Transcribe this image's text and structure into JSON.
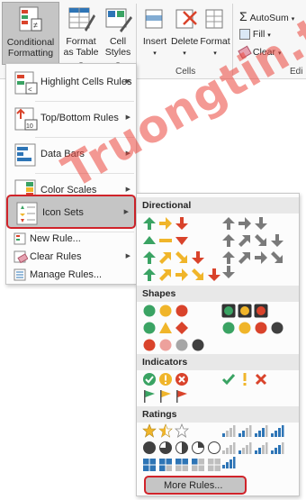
{
  "ribbon": {
    "conditional_formatting": "Conditional Formatting",
    "format_as_table": "Format as Table",
    "cell_styles": "Cell Styles",
    "insert": "Insert",
    "delete": "Delete",
    "format": "Format",
    "cells_group": "Cells",
    "autosum": "AutoSum",
    "fill": "Fill",
    "clear": "Clear",
    "editing_group_partial": "Edi"
  },
  "menu": {
    "items": [
      {
        "label": "Highlight Cells Rules",
        "has_submenu": true
      },
      {
        "label": "Top/Bottom Rules",
        "has_submenu": true
      },
      {
        "label": "Data Bars",
        "has_submenu": true
      },
      {
        "label": "Color Scales",
        "has_submenu": true
      },
      {
        "label": "Icon Sets",
        "has_submenu": true,
        "selected": true
      },
      {
        "label": "New Rule..."
      },
      {
        "label": "Clear Rules",
        "has_submenu": true
      },
      {
        "label": "Manage Rules..."
      }
    ]
  },
  "submenu": {
    "sections": [
      {
        "title": "Directional"
      },
      {
        "title": "Shapes"
      },
      {
        "title": "Indicators"
      },
      {
        "title": "Ratings"
      }
    ],
    "more_rules": "More Rules..."
  },
  "watermark": "Truongtin.top",
  "colors": {
    "green": "#3aa363",
    "yellow": "#f0b52a",
    "red": "#d9432b",
    "gray": "#7a7a7a",
    "blue": "#2e75b6",
    "highlight_border": "#d0232a"
  }
}
